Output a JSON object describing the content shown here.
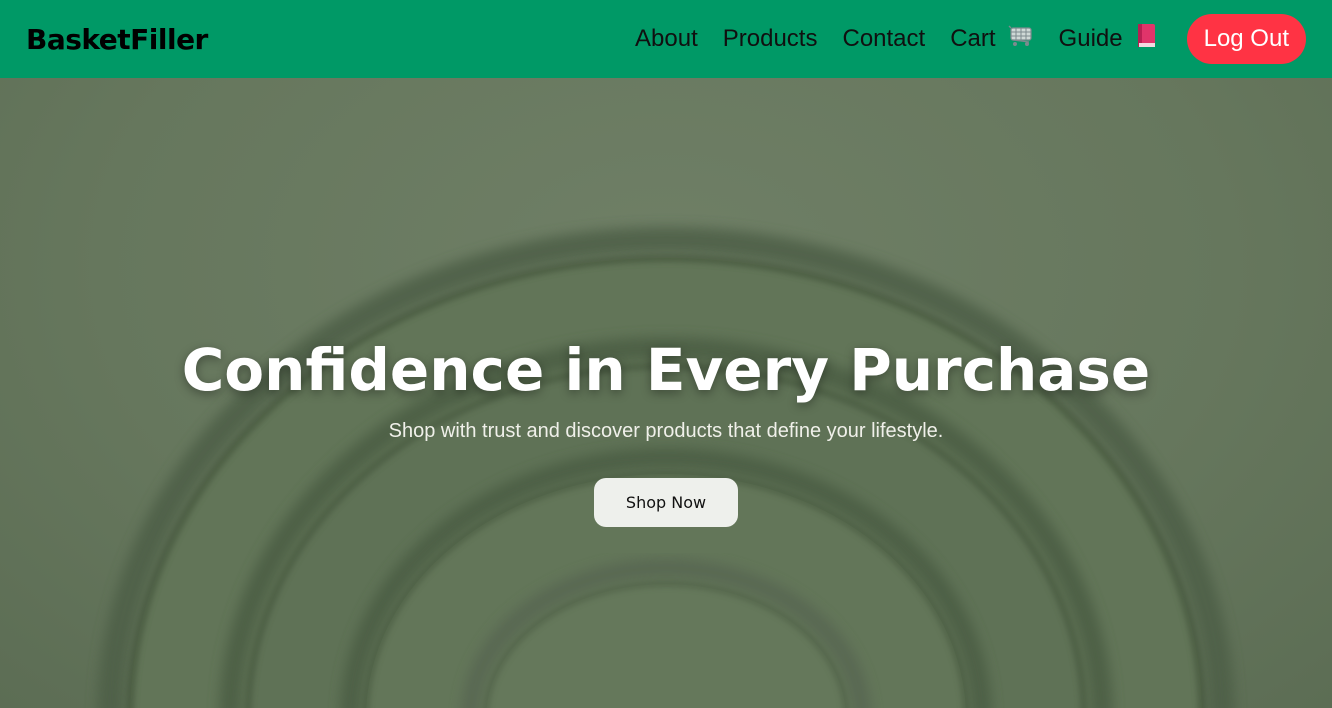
{
  "nav": {
    "brand": "BasketFiller",
    "links": [
      {
        "label": "About"
      },
      {
        "label": "Products"
      },
      {
        "label": "Contact"
      },
      {
        "label": "Cart",
        "icon": "shopping-cart-icon"
      },
      {
        "label": "Guide",
        "icon": "book-icon"
      }
    ],
    "logout_label": "Log Out"
  },
  "hero": {
    "title": "Confidence in Every Purchase",
    "subtitle": "Shop with trust and discover products that define your lifestyle.",
    "cta_label": "Shop Now"
  },
  "colors": {
    "nav_bg": "#009966",
    "logout_bg": "#ff3344",
    "hero_bg": "#6a7a60"
  }
}
